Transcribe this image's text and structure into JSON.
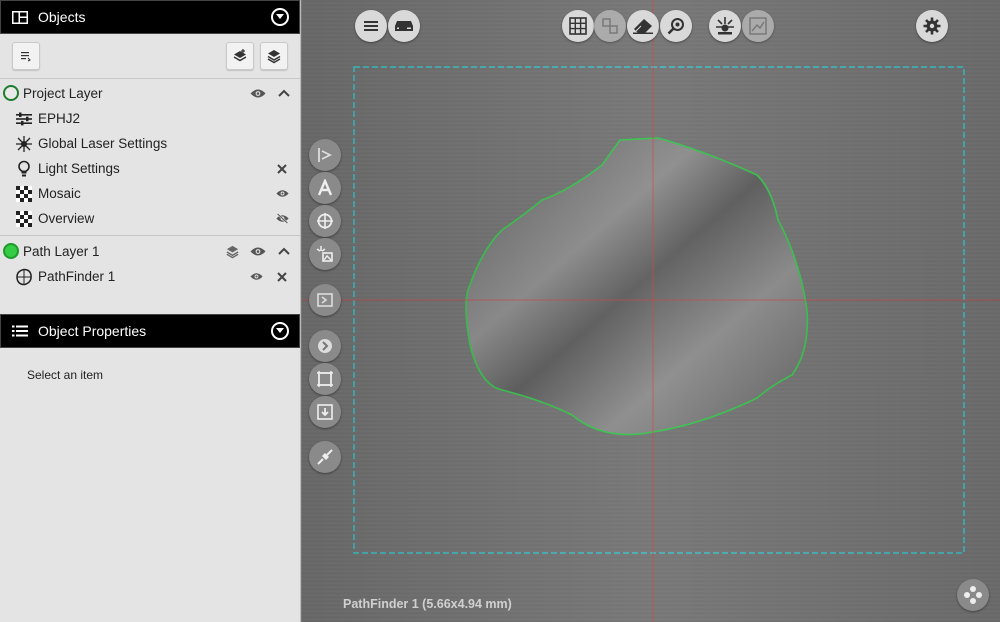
{
  "objects_panel": {
    "title": "Objects",
    "project_layer": {
      "label": "Project Layer",
      "items": [
        {
          "label": "EPHJ2",
          "icon": "sliders-icon"
        },
        {
          "label": "Global Laser Settings",
          "icon": "laser-icon"
        },
        {
          "label": "Light Settings",
          "icon": "lightbulb-icon"
        },
        {
          "label": "Mosaic",
          "icon": "checker-icon"
        },
        {
          "label": "Overview",
          "icon": "checker-icon"
        }
      ]
    },
    "path_layer": {
      "label": "Path Layer 1",
      "items": [
        {
          "label": "PathFinder 1",
          "icon": "pathfinder-icon"
        }
      ]
    }
  },
  "properties_panel": {
    "title": "Object Properties",
    "empty_message": "Select an item"
  },
  "canvas": {
    "status_text": "PathFinder 1 (5.66x4.94 mm)"
  },
  "colors": {
    "project_dot": "#1d7d2e",
    "path_dot": "#33cc44",
    "blob_outline": "#35c24a",
    "frame": "#2fd0d6",
    "crosshair": "#d23a3a"
  }
}
